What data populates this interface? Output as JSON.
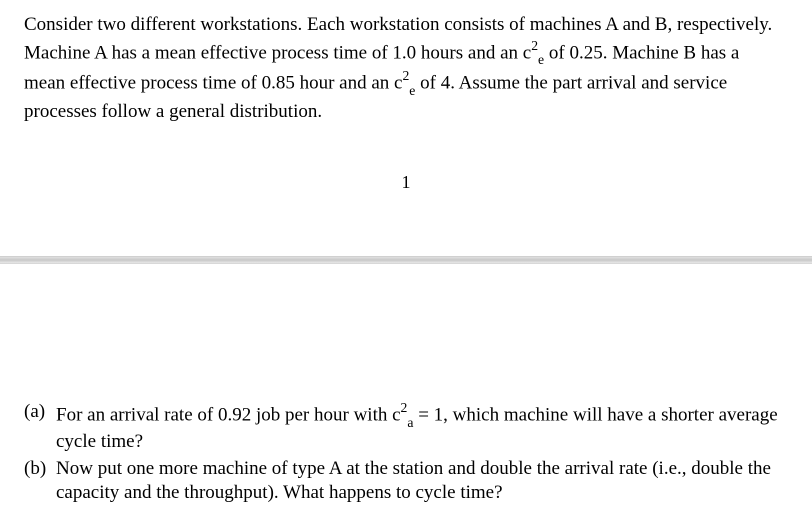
{
  "intro": {
    "line1_pre": "Consider two different workstations. Each workstation consists of machines A and B, respectively. Machine A has a mean effective process time of 1.0 hours and an c",
    "line1_sub": "e",
    "line1_sup": "2",
    "line1_post": " of 0.25. Machine B has a mean effective process time of 0.85 hour and an c",
    "line2_sub": "e",
    "line2_sup": "2",
    "line2_post": " of 4. Assume the part arrival and service processes follow a general distribution."
  },
  "page_number": "1",
  "questions": {
    "a": {
      "label": "(a)",
      "pre": "For an arrival rate of 0.92 job per hour with c",
      "sub": "a",
      "sup": "2",
      "post": " = 1, which machine will have a shorter average cycle time?"
    },
    "b": {
      "label": "(b)",
      "text": "Now put one more machine of type A at the station and double the arrival rate (i.e., double the capacity and the throughput). What happens to cycle time?"
    }
  }
}
